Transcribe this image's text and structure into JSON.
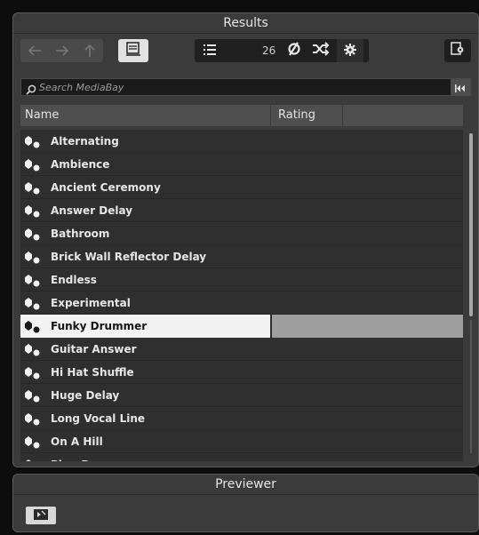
{
  "results": {
    "title": "Results",
    "count": "26",
    "search": {
      "placeholder": "Search MediaBay",
      "value": ""
    },
    "columns": {
      "name": "Name",
      "rating": "Rating"
    },
    "rows": [
      {
        "name": "Alternating"
      },
      {
        "name": "Ambience"
      },
      {
        "name": "Ancient Ceremony"
      },
      {
        "name": "Answer Delay"
      },
      {
        "name": "Bathroom"
      },
      {
        "name": "Brick Wall Reflector Delay"
      },
      {
        "name": "Endless"
      },
      {
        "name": "Experimental"
      },
      {
        "name": "Funky Drummer",
        "selected": true
      },
      {
        "name": "Guitar Answer"
      },
      {
        "name": "Hi Hat Shuffle"
      },
      {
        "name": "Huge Delay"
      },
      {
        "name": "Long Vocal Line"
      },
      {
        "name": "On A Hill"
      },
      {
        "name": "Ping Pong"
      }
    ],
    "icons": {
      "back": "arrow-left-icon",
      "forward": "arrow-right-icon",
      "up": "arrow-up-icon",
      "folder": "browse-folder-icon",
      "list": "list-view-icon",
      "refresh": "refresh-icon",
      "shuffle": "shuffle-icon",
      "settings": "gear-icon",
      "export": "export-icon",
      "search": "search-icon",
      "reset": "rewind-icon"
    }
  },
  "previewer": {
    "title": "Previewer"
  },
  "colors": {
    "selected_row": "#f2f2f2",
    "selected_rating": "#9e9e9e",
    "panel": "#3b3b3b"
  }
}
